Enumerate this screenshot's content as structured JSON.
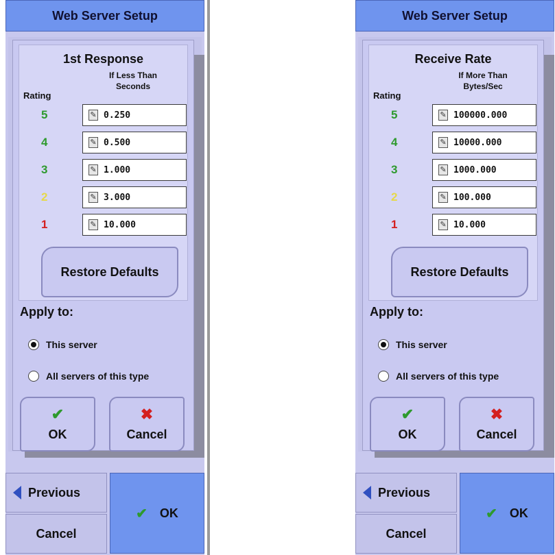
{
  "colors": {
    "accent_blue": "#6f94ee",
    "panel_lavender": "#c9c9f1",
    "rating_5": "#2e9a2e",
    "rating_4": "#2e9a2e",
    "rating_3": "#2e9a2e",
    "rating_2": "#e6d84a",
    "rating_1": "#d42020",
    "ok_check": "#2e9a2e",
    "cancel_x": "#d42020"
  },
  "screens": [
    {
      "title": "Web Server Setup",
      "metric_title": "1st Response",
      "column_header_line1": "If Less Than",
      "column_header_line2": "Seconds",
      "rating_label": "Rating",
      "rows": [
        {
          "rating": "5",
          "value": "0.250"
        },
        {
          "rating": "4",
          "value": "0.500"
        },
        {
          "rating": "3",
          "value": "1.000"
        },
        {
          "rating": "2",
          "value": "3.000"
        },
        {
          "rating": "1",
          "value": "10.000"
        }
      ],
      "restore_label": "Restore Defaults",
      "apply_label": "Apply to:",
      "radio_this": "This server",
      "radio_all": "All servers of this type",
      "radio_selected": "This server",
      "ok_label": "OK",
      "cancel_label": "Cancel",
      "nav_previous": "Previous",
      "nav_cancel": "Cancel",
      "nav_ok": "OK"
    },
    {
      "title": "Web Server Setup",
      "metric_title": "Receive Rate",
      "column_header_line1": "If More Than",
      "column_header_line2": "Bytes/Sec",
      "rating_label": "Rating",
      "rows": [
        {
          "rating": "5",
          "value": "100000.000"
        },
        {
          "rating": "4",
          "value": "10000.000"
        },
        {
          "rating": "3",
          "value": "1000.000"
        },
        {
          "rating": "2",
          "value": "100.000"
        },
        {
          "rating": "1",
          "value": "10.000"
        }
      ],
      "restore_label": "Restore Defaults",
      "apply_label": "Apply to:",
      "radio_this": "This server",
      "radio_all": "All servers of this type",
      "radio_selected": "This server",
      "ok_label": "OK",
      "cancel_label": "Cancel",
      "nav_previous": "Previous",
      "nav_cancel": "Cancel",
      "nav_ok": "OK"
    }
  ],
  "icons": {
    "field_icon": "edit-icon",
    "ok_icon": "checkmark-icon",
    "cancel_icon": "x-icon",
    "previous_icon": "left-arrow-icon"
  }
}
